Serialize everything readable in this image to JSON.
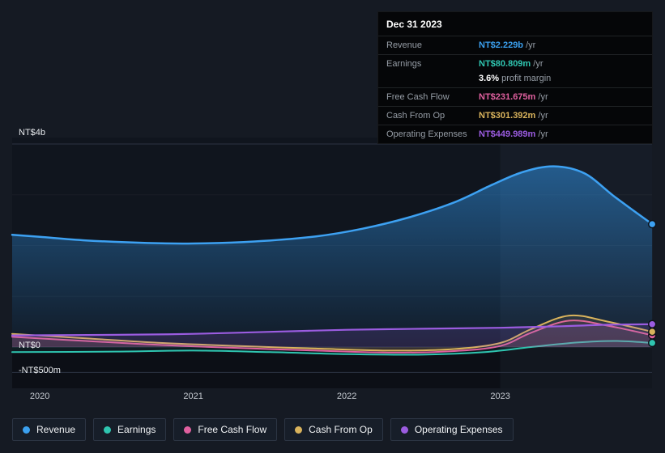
{
  "tooltip": {
    "date": "Dec 31 2023",
    "rows": [
      {
        "label": "Revenue",
        "value": "NT$2.229b",
        "suffix": "/yr",
        "color": "#3ba0ef"
      },
      {
        "label": "Earnings",
        "value": "NT$80.809m",
        "suffix": "/yr",
        "color": "#2fc5b0",
        "sub": {
          "value": "3.6%",
          "label": "profit margin"
        }
      },
      {
        "label": "Free Cash Flow",
        "value": "NT$231.675m",
        "suffix": "/yr",
        "color": "#e0609f"
      },
      {
        "label": "Cash From Op",
        "value": "NT$301.392m",
        "suffix": "/yr",
        "color": "#d9b35c"
      },
      {
        "label": "Operating Expenses",
        "value": "NT$449.989m",
        "suffix": "/yr",
        "color": "#9b5ce0"
      }
    ]
  },
  "legend": {
    "items": [
      {
        "label": "Revenue",
        "color": "#3ba0ef"
      },
      {
        "label": "Earnings",
        "color": "#2fc5b0"
      },
      {
        "label": "Free Cash Flow",
        "color": "#e0609f"
      },
      {
        "label": "Cash From Op",
        "color": "#d9b35c"
      },
      {
        "label": "Operating Expenses",
        "color": "#9b5ce0"
      }
    ]
  },
  "chart_data": {
    "type": "area",
    "title": "",
    "x_unit": "year",
    "x_ticks": [
      "2020",
      "2021",
      "2022",
      "2023"
    ],
    "x_tick_values": [
      2020,
      2021,
      2022,
      2023
    ],
    "x_range": [
      2019.82,
      2023.99
    ],
    "y_unit": "NT$ billions",
    "ylim": [
      -0.75,
      4.3
    ],
    "grid": "horizontal",
    "legend_position": "bottom",
    "highlight_from_x": 2023.0,
    "y_axis_labels": [
      {
        "text": "NT$4b",
        "value": 4.0
      },
      {
        "text": "NT$0",
        "value": 0.0
      },
      {
        "text": "-NT$500m",
        "value": -0.5
      }
    ],
    "faint_gridline_values": [
      3.0,
      2.0,
      1.0
    ],
    "series": [
      {
        "name": "Revenue",
        "color": "#3da1f2",
        "width": 2.5,
        "fill": "gradient",
        "x": [
          2019.82,
          2020.0,
          2020.3,
          2020.7,
          2021.0,
          2021.4,
          2021.8,
          2022.1,
          2022.4,
          2022.7,
          2022.95,
          2023.15,
          2023.35,
          2023.55,
          2023.75,
          2023.99
        ],
        "y": [
          2.21,
          2.17,
          2.1,
          2.05,
          2.04,
          2.08,
          2.18,
          2.33,
          2.55,
          2.85,
          3.2,
          3.45,
          3.56,
          3.42,
          2.95,
          2.42
        ]
      },
      {
        "name": "Earnings",
        "color": "#2fc5b0",
        "width": 2,
        "fill": 0.08,
        "x": [
          2019.82,
          2020.5,
          2021.0,
          2021.5,
          2022.0,
          2022.5,
          2022.9,
          2023.2,
          2023.5,
          2023.75,
          2023.99
        ],
        "y": [
          -0.1,
          -0.09,
          -0.07,
          -0.1,
          -0.14,
          -0.15,
          -0.1,
          0.0,
          0.09,
          0.12,
          0.081
        ]
      },
      {
        "name": "Free Cash Flow",
        "color": "#e0609f",
        "width": 2,
        "fill": 0.1,
        "x": [
          2019.82,
          2020.3,
          2020.8,
          2021.3,
          2021.8,
          2022.3,
          2022.7,
          2023.0,
          2023.2,
          2023.45,
          2023.7,
          2023.99
        ],
        "y": [
          0.2,
          0.12,
          0.04,
          -0.02,
          -0.07,
          -0.11,
          -0.08,
          0.02,
          0.28,
          0.52,
          0.42,
          0.232
        ]
      },
      {
        "name": "Cash From Op",
        "color": "#d9b35c",
        "width": 2,
        "fill": 0.1,
        "x": [
          2019.82,
          2020.3,
          2020.8,
          2021.3,
          2021.8,
          2022.3,
          2022.7,
          2023.0,
          2023.2,
          2023.45,
          2023.7,
          2023.99
        ],
        "y": [
          0.26,
          0.17,
          0.08,
          0.02,
          -0.03,
          -0.07,
          -0.04,
          0.08,
          0.35,
          0.62,
          0.5,
          0.301
        ]
      },
      {
        "name": "Operating Expenses",
        "color": "#9b5ce0",
        "width": 2.2,
        "fill": 0.16,
        "x": [
          2019.82,
          2020.5,
          2021.0,
          2021.5,
          2022.0,
          2022.5,
          2023.0,
          2023.4,
          2023.7,
          2023.99
        ],
        "y": [
          0.23,
          0.24,
          0.26,
          0.3,
          0.34,
          0.36,
          0.38,
          0.41,
          0.44,
          0.45
        ]
      }
    ]
  }
}
